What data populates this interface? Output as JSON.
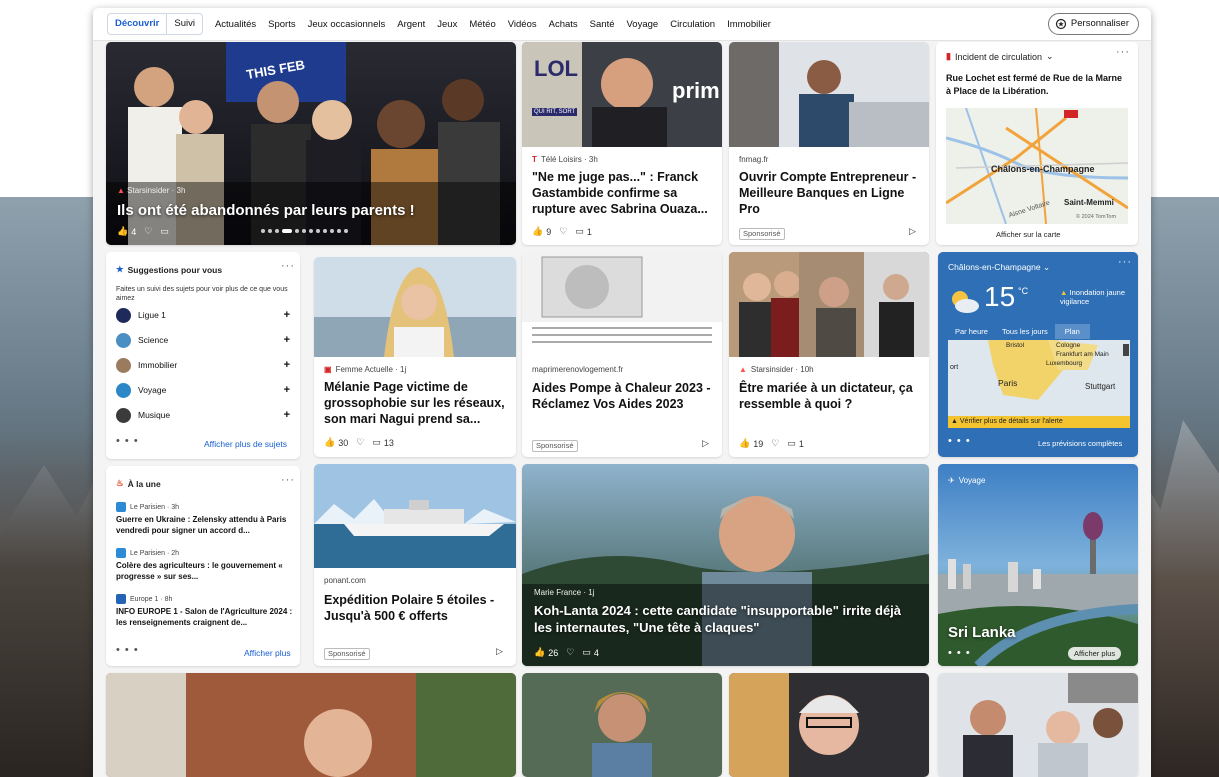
{
  "nav": {
    "segment": [
      "Découvrir",
      "Suivi"
    ],
    "items": [
      "Actualités",
      "Sports",
      "Jeux occasionnels",
      "Argent",
      "Jeux",
      "Météo",
      "Vidéos",
      "Achats",
      "Santé",
      "Voyage",
      "Circulation",
      "Immobilier"
    ],
    "personalize": "Personnaliser"
  },
  "hero": {
    "source": "Starsinsider · 3h",
    "title": "Ils ont été abandonnés par leurs parents !",
    "likes": "4",
    "banner_text": "THIS FEB"
  },
  "card_franck": {
    "source": "Télé Loisirs · 3h",
    "title": "\"Ne me juge pas...\" : Franck Gastambide confirme sa rupture avec Sabrina Ouaza...",
    "likes": "9",
    "comments": "1",
    "img_text_1": "prim",
    "img_text_2": "LOL",
    "img_text_3": "QUI RIT, SORT"
  },
  "card_compte": {
    "source": "fnmag.fr",
    "title": "Ouvrir Compte Entrepreneur - Meilleure Banques en Ligne Pro",
    "sponsor": "Sponsorisé"
  },
  "traffic": {
    "heading": "Incident de circulation",
    "text": "Rue Lochet est fermé de Rue de la Marne à Place de la Libération.",
    "map_city": "Châlons-en-Champagne",
    "map_town1": "Saint-Memmi",
    "map_town2": "Aisne Voltaire",
    "map_copyright": "© 2024 TomTom",
    "link": "Afficher sur la carte"
  },
  "suggestions": {
    "heading": "Suggestions pour vous",
    "sub": "Faites un suivi des sujets pour voir plus de ce que vous aimez",
    "items": [
      "Ligue 1",
      "Science",
      "Immobilier",
      "Voyage",
      "Musique"
    ],
    "more": "Afficher plus de sujets"
  },
  "card_melanie": {
    "source": "Femme Actuelle · 1j",
    "title": "Mélanie Page victime de grossophobie sur les réseaux, son mari Nagui prend sa...",
    "likes": "30",
    "comments": "13"
  },
  "card_pompe": {
    "source": "maprimerenovlogement.fr",
    "title": "Aides Pompe à Chaleur 2023 - Réclamez Vos Aides 2023",
    "sponsor": "Sponsorisé"
  },
  "card_dictateur": {
    "source": "Starsinsider · 10h",
    "title": "Être mariée à un dictateur, ça ressemble à quoi ?",
    "likes": "19",
    "comments": "1"
  },
  "weather": {
    "city": "Châlons-en-Champagne",
    "temp": "15",
    "unit": "°C",
    "alert": "Inondation jaune vigilance",
    "tabs": [
      "Par heure",
      "Tous les jours",
      "Plan"
    ],
    "map_labels": [
      "Bristol",
      "Cologne",
      "Frankfurt am Main",
      "Luxembourg",
      "Paris",
      "Stuttgart",
      "ort"
    ],
    "warning": "Vérifier plus de détails sur l'alerte",
    "forecast": "Les prévisions complètes"
  },
  "alaune": {
    "heading": "À la une",
    "items": [
      {
        "source": "Le Parisien · 3h",
        "text": "Guerre en Ukraine : Zelensky attendu à Paris vendredi pour signer un accord d..."
      },
      {
        "source": "Le Parisien · 2h",
        "text": "Colère des agriculteurs : le gouvernement « progresse » sur ses..."
      },
      {
        "source": "Europe 1 · 8h",
        "text": "INFO EUROPE 1 - Salon de l'Agriculture 2024 : les renseignements craignent de..."
      }
    ],
    "more": "Afficher plus"
  },
  "card_ponant": {
    "source": "ponant.com",
    "title": "Expédition Polaire 5 étoiles - Jusqu'à 500 € offerts",
    "sponsor": "Sponsorisé"
  },
  "card_kohlanta": {
    "source": "Marie France · 1j",
    "title": "Koh-Lanta 2024 : cette candidate \"insupportable\" irrite déjà les internautes, \"Une tête à claques\"",
    "likes": "26",
    "comments": "4"
  },
  "voyage": {
    "label": "Voyage",
    "title": "Sri Lanka",
    "more": "Afficher plus"
  },
  "colors": {
    "accent": "#1a5fd0",
    "weather_bg": "#2f6fb5",
    "red": "#d32525"
  }
}
